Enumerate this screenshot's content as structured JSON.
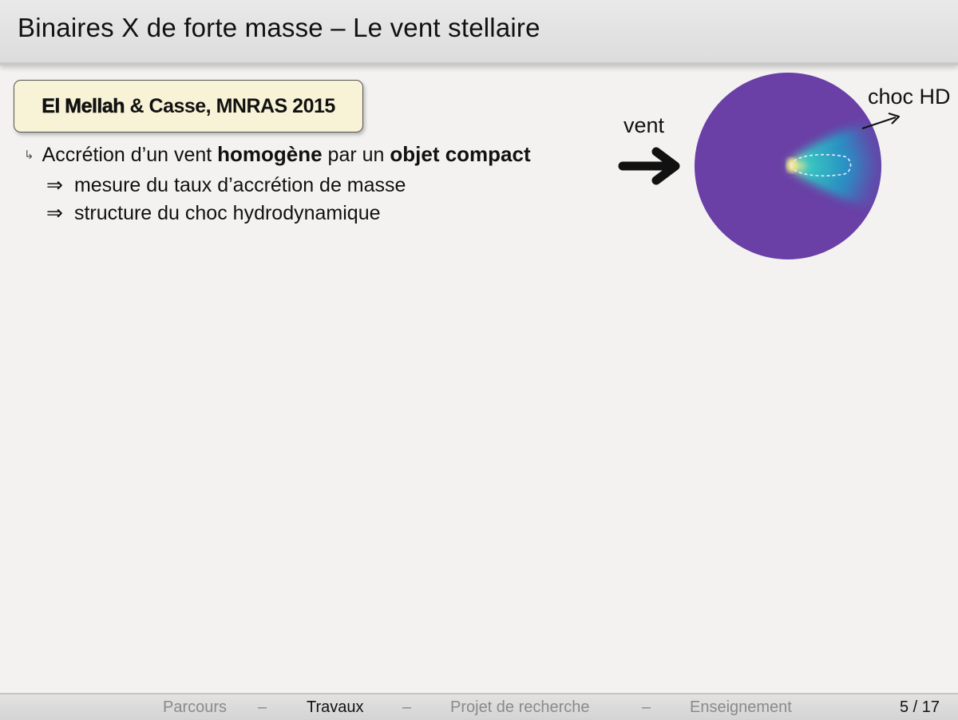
{
  "slide": {
    "title": "Binaires X de forte masse – Le vent stellaire",
    "reference": {
      "authors_bold": "El Mellah",
      "rest": " & Casse, MNRAS 2015"
    },
    "bullets": {
      "line1_a": "Accrétion d’un vent ",
      "line1_b": "homogène",
      "line1_c": " par un ",
      "line1_d": "objet compact",
      "implies_symbol": "⇒",
      "sub1": "mesure du taux d’accrétion de masse",
      "sub2": "structure du choc hydrodynamique"
    },
    "figure": {
      "label_vent": "vent",
      "label_choc": "choc HD",
      "colors": {
        "disk": "#6a3fa6",
        "shock_inner": "#f4e88a",
        "shock_mid": "#38c8c0",
        "shock_outer": "#2a8fc4"
      }
    }
  },
  "nav": {
    "items": [
      "Parcours",
      "Travaux",
      "Projet de recherche",
      "Enseignement"
    ],
    "separator": "–",
    "active": "Travaux",
    "page": "5 / 17"
  }
}
